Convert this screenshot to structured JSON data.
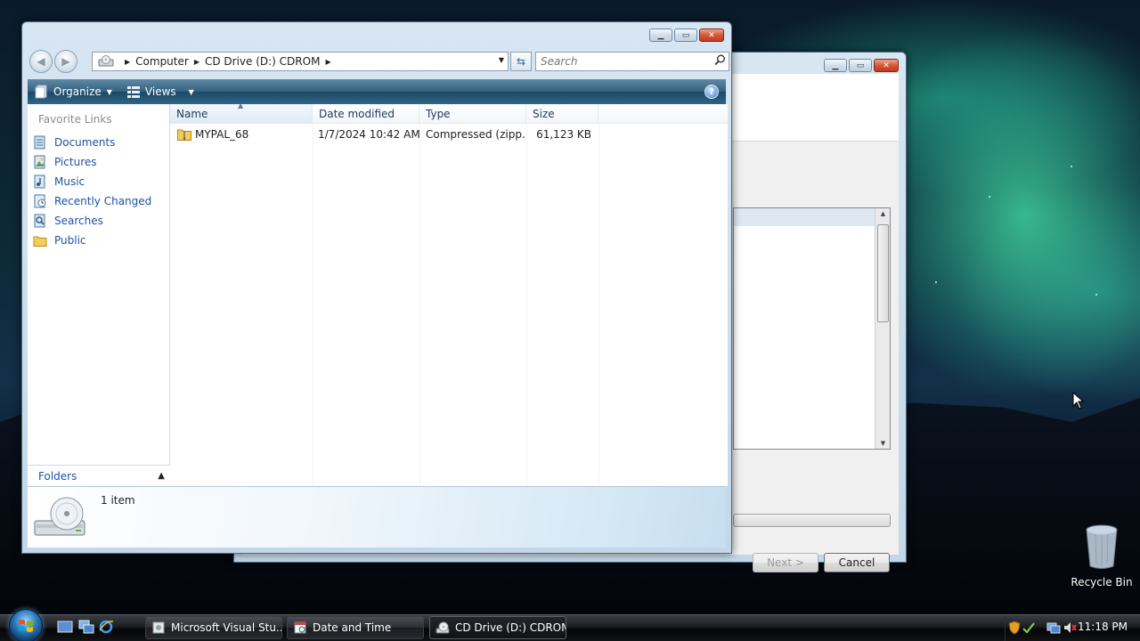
{
  "explorer": {
    "address": {
      "crumbs": [
        "Computer",
        "CD Drive (D:) CDROM"
      ]
    },
    "search_placeholder": "Search",
    "toolbar": {
      "organize_label": "Organize",
      "views_label": "Views"
    },
    "favorite_links_title": "Favorite Links",
    "favorite_links": [
      {
        "label": "Documents",
        "icon": "documents-icon"
      },
      {
        "label": "Pictures",
        "icon": "pictures-icon"
      },
      {
        "label": "Music",
        "icon": "music-icon"
      },
      {
        "label": "Recently Changed",
        "icon": "recently-changed-icon"
      },
      {
        "label": "Searches",
        "icon": "searches-icon"
      },
      {
        "label": "Public",
        "icon": "public-folder-icon"
      }
    ],
    "folders_label": "Folders",
    "columns": [
      "Name",
      "Date modified",
      "Type",
      "Size"
    ],
    "files": [
      {
        "name": "MYPAL_68",
        "date_modified": "1/7/2024 10:42 AM",
        "type": "Compressed (zipp...",
        "size": "61,123 KB",
        "icon": "zip-folder-icon"
      }
    ],
    "status": {
      "item_count": "1 item"
    }
  },
  "wizard": {
    "next_label": "Next >",
    "cancel_label": "Cancel"
  },
  "desktop": {
    "recycle_bin_label": "Recycle Bin"
  },
  "taskbar": {
    "buttons": [
      {
        "label": "Microsoft Visual Stu...",
        "icon": "installer-icon"
      },
      {
        "label": "Date and Time",
        "icon": "date-time-icon"
      },
      {
        "label": "CD Drive (D:) CDROM",
        "icon": "cd-drive-icon",
        "active": true
      }
    ],
    "clock": "11:18 PM"
  },
  "colors": {
    "link_blue": "#1d52a8",
    "command_bar": "#2f6585"
  }
}
